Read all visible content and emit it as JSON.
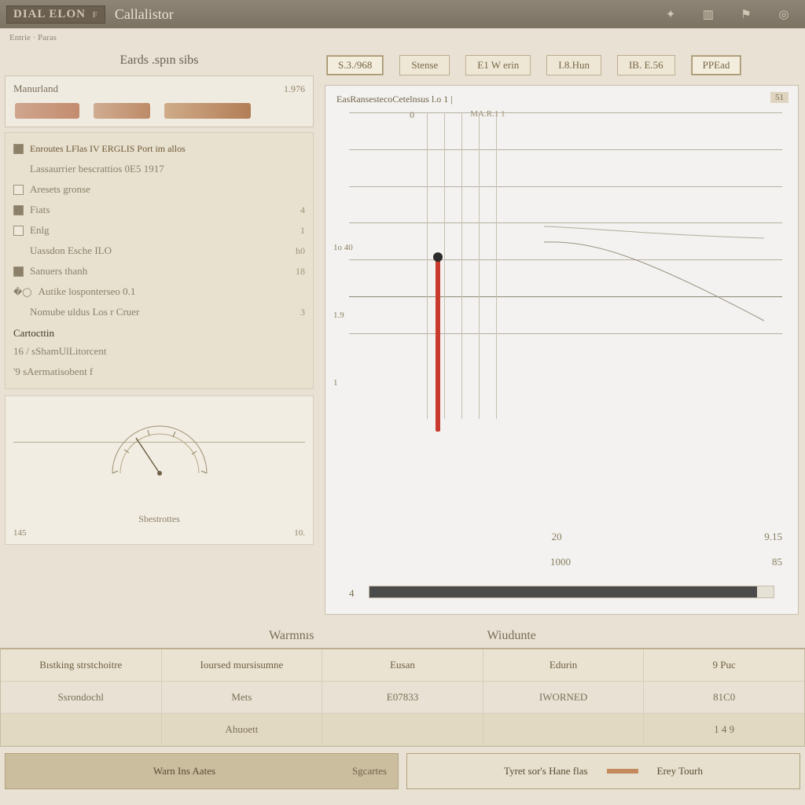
{
  "titlebar": {
    "badge": "DIAL ELON",
    "suffix": "F",
    "window_title": "Callalistor"
  },
  "crumb": "Entrie · Paras",
  "sidebar": {
    "title": "Eards .spın sibs",
    "material": {
      "label": "Manurland",
      "value": "1.976"
    },
    "options": [
      {
        "icon": "sq",
        "checked": true,
        "label": "Enroutes LFlas IV ERGLIS Port im allos",
        "rv": ""
      },
      {
        "icon": "none",
        "checked": false,
        "label": "Lassaurrier bescrattios  0E5  1917",
        "rv": ""
      },
      {
        "icon": "sq",
        "checked": false,
        "label": "Aresets gronse",
        "rv": ""
      },
      {
        "icon": "sq",
        "checked": true,
        "label": "Fiats",
        "rv": "4"
      },
      {
        "icon": "sq",
        "checked": false,
        "label": "Enlg",
        "rv": "1"
      },
      {
        "icon": "none",
        "checked": false,
        "label": "Uassdon Esche ILO",
        "rv": "h0"
      },
      {
        "icon": "sq",
        "checked": true,
        "label": "Sanuers thanh",
        "rv": "18"
      },
      {
        "icon": "dot",
        "checked": false,
        "label": "Autike losponterseo 0.1",
        "rv": ""
      },
      {
        "icon": "none",
        "checked": false,
        "label": "Nomube uldus Los r Cruer",
        "rv": "3"
      }
    ],
    "subsection": "Cartocttin",
    "sub_options": [
      {
        "label": "16 /  sShamUlLitorcent",
        "rv": ""
      },
      {
        "label": "'9  sAermatisobent f",
        "rv": ""
      }
    ],
    "dial": {
      "caption": "Sbestrottes",
      "left": "145",
      "right": "10."
    }
  },
  "tabs": [
    {
      "label": "S.3./968",
      "active": true
    },
    {
      "label": "Stense",
      "active": false
    },
    {
      "label": "E1  W erin",
      "active": false
    },
    {
      "label": "I.8.Hun",
      "active": false
    },
    {
      "label": "IB. E.56",
      "active": false
    },
    {
      "label": "PPEad",
      "active": true
    }
  ],
  "canvas": {
    "title": "EasRansestecoCetelnsus l.o 1 |",
    "badge": "51",
    "top_ticks": [
      "0",
      "MA.R.1 1",
      ""
    ],
    "left_labels": [
      "1o 40",
      "1.9",
      "1"
    ],
    "axis2": [
      "",
      "20",
      "9.15"
    ],
    "axis": [
      "",
      "1000",
      "85"
    ],
    "progress_left": "4",
    "progress_pct": 96
  },
  "section": {
    "left_title": "Warmnıs",
    "right_title": "Wiudunte"
  },
  "table": {
    "headers": [
      "Bıstking strstchoitre",
      "Ioursed mursisumne",
      "Eusan",
      "Edurin",
      "9 Puc"
    ],
    "row1": [
      "Ssrondochl",
      "Mets",
      "E07833",
      "IWORNED",
      "81C0"
    ],
    "row2": [
      "",
      "Ahuoett",
      "",
      "",
      "1 4 9"
    ]
  },
  "buttons": {
    "primary": "Warn Ins Aates",
    "primary_rv": "Sgcartes",
    "secondary": "Tyret sor's Hane flas",
    "secondary_rv": "Erey Tourh"
  }
}
